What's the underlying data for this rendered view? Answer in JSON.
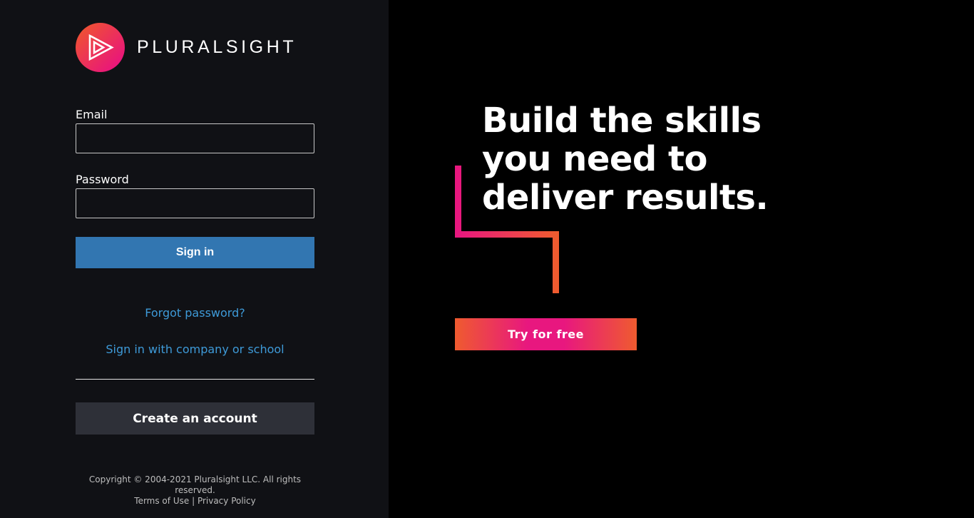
{
  "brand": {
    "name": "PLURALSIGHT",
    "logo_icon": "play-triangle-icon",
    "gradient_start": "#f05a28",
    "gradient_end": "#e80a89"
  },
  "login_form": {
    "email_label": "Email",
    "email_value": "",
    "password_label": "Password",
    "password_value": "",
    "signin_label": "Sign in",
    "signin_color": "#3276b1",
    "forgot_password_label": "Forgot password?",
    "company_signin_label": "Sign in with company or school",
    "link_color": "#3e9ad8",
    "create_account_label": "Create an account"
  },
  "footer": {
    "copyright": "Copyright © 2004-2021 Pluralsight LLC. All rights reserved.",
    "terms_label": "Terms of Use",
    "separator": "|",
    "privacy_label": "Privacy Policy"
  },
  "promo": {
    "headline_lines": [
      "Build the skills",
      "you need to",
      "deliver results."
    ],
    "cta_label": "Try for free",
    "accent_pink": "#e8177f",
    "accent_orange": "#ef5b2f"
  }
}
